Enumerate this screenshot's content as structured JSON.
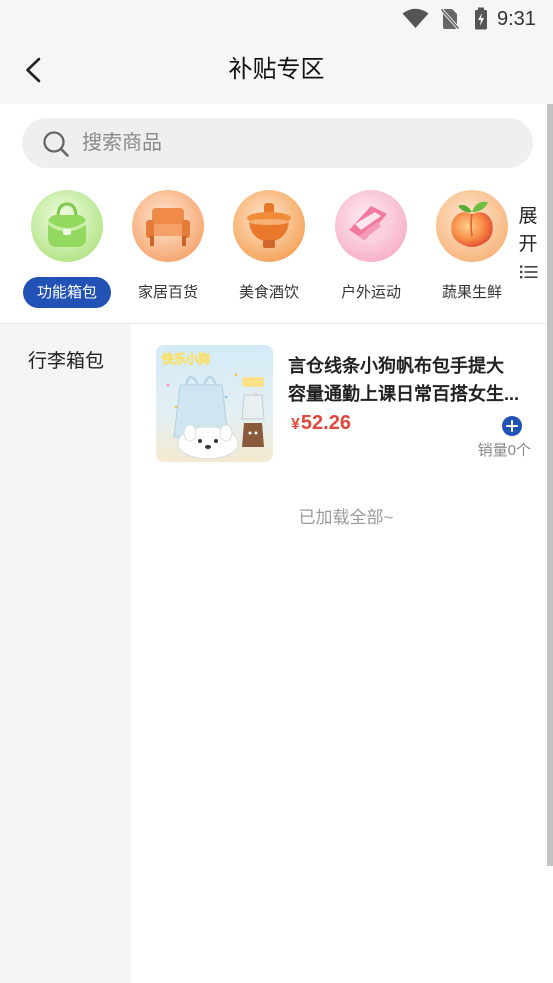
{
  "status_bar": {
    "time": "9:31",
    "icons": [
      "wifi-icon",
      "no-sim-icon",
      "battery-charging-icon"
    ]
  },
  "header": {
    "title": "补贴专区",
    "back_icon": "chevron-left-icon"
  },
  "search": {
    "placeholder": "搜索商品",
    "value": "",
    "icon": "search-icon"
  },
  "categories": [
    {
      "label": "功能箱包",
      "selected": true,
      "icon": "handbag-icon"
    },
    {
      "label": "家居百货",
      "selected": false,
      "icon": "armchair-icon"
    },
    {
      "label": "美食酒饮",
      "selected": false,
      "icon": "hotpot-icon"
    },
    {
      "label": "户外运动",
      "selected": false,
      "icon": "ribbon-icon"
    },
    {
      "label": "蔬果生鲜",
      "selected": false,
      "icon": "peach-icon"
    }
  ],
  "expand": {
    "char1": "展",
    "char2": "开",
    "icon": "list-icon"
  },
  "sidebar": {
    "items": [
      {
        "label": "行李箱包",
        "selected": true
      }
    ]
  },
  "products": [
    {
      "title": "言仓线条小狗帆布包手提大容量通勤上课日常百搭女生...",
      "currency": "¥",
      "price": "52.26",
      "sales": "销量0个",
      "image_text": "快乐小狗",
      "add_icon": "plus-circle-icon"
    }
  ],
  "footer_note": "已加载全部~",
  "colors": {
    "accent": "#2252b6",
    "price": "#e2473d",
    "header_bg": "#f6f6f6",
    "sidebar_bg": "#f5f5f5",
    "search_bg": "#efefef"
  }
}
